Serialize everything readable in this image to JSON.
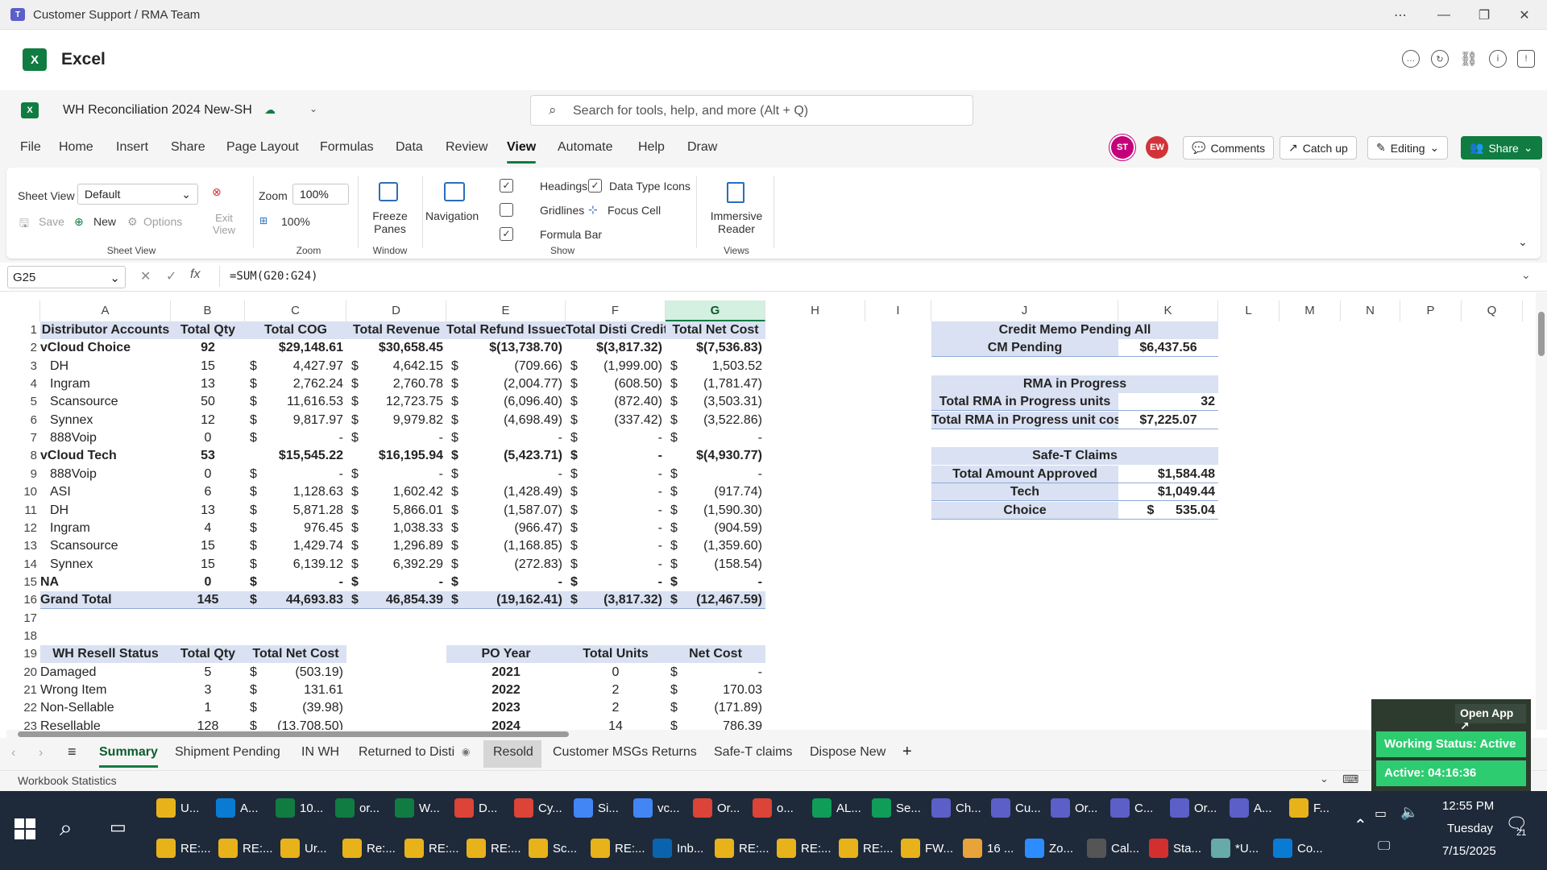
{
  "window": {
    "title": "Customer Support / RMA Team"
  },
  "app": {
    "name": "Excel"
  },
  "doc": {
    "name": "WH Reconciliation 2024 New-SH"
  },
  "search": {
    "placeholder": "Search for tools, help, and more (Alt + Q)"
  },
  "menu": [
    "File",
    "Home",
    "Insert",
    "Share",
    "Page Layout",
    "Formulas",
    "Data",
    "Review",
    "View",
    "Automate",
    "Help",
    "Draw"
  ],
  "menu_active": "View",
  "collaborators": [
    {
      "initials": "ST",
      "color": "#c4007a"
    },
    {
      "initials": "EW",
      "color": "#d13438"
    }
  ],
  "header_buttons": {
    "comments": "Comments",
    "catchup": "Catch up",
    "editing": "Editing",
    "share": "Share"
  },
  "ribbon": {
    "sheet_view_label": "Sheet View",
    "sheet_view_value": "Default",
    "save": "Save",
    "new": "New",
    "options": "Options",
    "exit_view": "Exit View",
    "zoom_label": "Zoom",
    "zoom_value": "100%",
    "zoom_100": "100%",
    "freeze_panes": "Freeze Panes",
    "navigation": "Navigation",
    "headings": "Headings",
    "gridlines": "Gridlines",
    "formula_bar": "Formula Bar",
    "data_type_icons": "Data Type Icons",
    "focus_cell": "Focus Cell",
    "immersive_reader": "Immersive Reader",
    "groups": {
      "sheet_view": "Sheet View",
      "zoom": "Zoom",
      "window": "Window",
      "show": "Show",
      "views": "Views"
    },
    "checks": {
      "headings": true,
      "gridlines": false,
      "formula_bar": true,
      "data_type_icons": true
    }
  },
  "formula_bar": {
    "name_box": "G25",
    "formula": "=SUM(G20:G24)"
  },
  "columns": [
    "A",
    "B",
    "C",
    "D",
    "E",
    "F",
    "G",
    "H",
    "I",
    "J",
    "K",
    "L",
    "M",
    "N",
    "P",
    "Q"
  ],
  "rows": [
    "1",
    "2",
    "3",
    "4",
    "5",
    "6",
    "7",
    "8",
    "9",
    "10",
    "11",
    "12",
    "13",
    "14",
    "15",
    "16",
    "17",
    "18",
    "19",
    "20",
    "21",
    "22",
    "23"
  ],
  "table1": {
    "headers": [
      "Distributor Accounts",
      "Total Qty",
      "Total COG",
      "Total Revenue",
      "Total Refund Issued",
      "Total Disti Credit",
      "Total Net Cost"
    ],
    "rows": [
      {
        "name": "vCloud Choice",
        "qty": "92",
        "cog": "$29,148.61",
        "rev": "$30,658.45",
        "ref": "$(13,738.70)",
        "cred": "$(3,817.32)",
        "net": "$(7,536.83)",
        "style": "sub"
      },
      {
        "name": "DH",
        "qty": "15",
        "cog": "4,427.97",
        "rev": "4,642.15",
        "ref": "(709.66)",
        "cred": "(1,999.00)",
        "net": "1,503.52"
      },
      {
        "name": "Ingram",
        "qty": "13",
        "cog": "2,762.24",
        "rev": "2,760.78",
        "ref": "(2,004.77)",
        "cred": "(608.50)",
        "net": "(1,781.47)"
      },
      {
        "name": "Scansource",
        "qty": "50",
        "cog": "11,616.53",
        "rev": "12,723.75",
        "ref": "(6,096.40)",
        "cred": "(872.40)",
        "net": "(3,503.31)"
      },
      {
        "name": "Synnex",
        "qty": "12",
        "cog": "9,817.97",
        "rev": "9,979.82",
        "ref": "(4,698.49)",
        "cred": "(337.42)",
        "net": "(3,522.86)"
      },
      {
        "name": "888Voip",
        "qty": "0",
        "cog": "-",
        "rev": "-",
        "ref": "-",
        "cred": "-",
        "net": "-"
      },
      {
        "name": "vCloud Tech",
        "qty": "53",
        "cog": "$15,545.22",
        "rev": "$16,195.94",
        "ref": "(5,423.71)",
        "cred": "-",
        "net": "$(4,930.77)",
        "style": "sub2"
      },
      {
        "name": "888Voip",
        "qty": "0",
        "cog": "-",
        "rev": "-",
        "ref": "-",
        "cred": "-",
        "net": "-"
      },
      {
        "name": "ASI",
        "qty": "6",
        "cog": "1,128.63",
        "rev": "1,602.42",
        "ref": "(1,428.49)",
        "cred": "-",
        "net": "(917.74)"
      },
      {
        "name": "DH",
        "qty": "13",
        "cog": "5,871.28",
        "rev": "5,866.01",
        "ref": "(1,587.07)",
        "cred": "-",
        "net": "(1,590.30)"
      },
      {
        "name": "Ingram",
        "qty": "4",
        "cog": "976.45",
        "rev": "1,038.33",
        "ref": "(966.47)",
        "cred": "-",
        "net": "(904.59)"
      },
      {
        "name": "Scansource",
        "qty": "15",
        "cog": "1,429.74",
        "rev": "1,296.89",
        "ref": "(1,168.85)",
        "cred": "-",
        "net": "(1,359.60)"
      },
      {
        "name": "Synnex",
        "qty": "15",
        "cog": "6,139.12",
        "rev": "6,392.29",
        "ref": "(272.83)",
        "cred": "-",
        "net": "(158.54)"
      },
      {
        "name": "NA",
        "qty": "0",
        "cog": "-",
        "rev": "-",
        "ref": "-",
        "cred": "-",
        "net": "-",
        "style": "na"
      },
      {
        "name": "Grand Total",
        "qty": "145",
        "cog": "44,693.83",
        "rev": "46,854.39",
        "ref": "(19,162.41)",
        "cred": "(3,817.32)",
        "net": "(12,467.59)",
        "style": "total"
      }
    ]
  },
  "credit_memo": {
    "title": "Credit Memo Pending All",
    "label": "CM Pending",
    "value": "$6,437.56"
  },
  "rma": {
    "title": "RMA in Progress",
    "units_label": "Total RMA in Progress units",
    "units_value": "32",
    "cost_label": "Total RMA in Progress unit cost",
    "cost_value": "$7,225.07"
  },
  "safet": {
    "title": "Safe-T Claims",
    "rows": [
      {
        "label": "Total Amount Approved",
        "value": "$1,584.48"
      },
      {
        "label": "Tech",
        "value": "$1,049.44"
      },
      {
        "label": "Choice",
        "value": "$      535.04"
      }
    ]
  },
  "resell": {
    "headers": [
      "WH Resell Status",
      "Total Qty",
      "Total Net Cost"
    ],
    "rows": [
      {
        "name": "Damaged",
        "qty": "5",
        "cost": "(503.19)"
      },
      {
        "name": "Wrong Item",
        "qty": "3",
        "cost": "131.61"
      },
      {
        "name": "Non-Sellable",
        "qty": "1",
        "cost": "(39.98)"
      },
      {
        "name": "Resellable",
        "qty": "128",
        "cost": "(13,708.50)"
      }
    ]
  },
  "po": {
    "headers": [
      "PO Year",
      "Total Units",
      "Net Cost"
    ],
    "rows": [
      {
        "year": "2021",
        "units": "0",
        "cost": "-"
      },
      {
        "year": "2022",
        "units": "2",
        "cost": "170.03"
      },
      {
        "year": "2023",
        "units": "2",
        "cost": "(171.89)"
      },
      {
        "year": "2024",
        "units": "14",
        "cost": "786.39"
      }
    ]
  },
  "sheet_tabs": [
    "Summary",
    "Shipment Pending",
    "IN WH",
    "Returned to Disti",
    "Resold",
    "Customer MSGs Returns",
    "Safe-T claims",
    "Dispose New"
  ],
  "active_tab": "Summary",
  "status_bar": {
    "left": "Workbook Statistics"
  },
  "widget": {
    "open_app": "Open App",
    "status": "Working Status: Active",
    "active": "Active: 04:16:36",
    "zoom": "100%"
  },
  "taskbar": {
    "row1": [
      {
        "label": "U...",
        "icon": "folder-icon",
        "color": "#e8b21a"
      },
      {
        "label": "A...",
        "icon": "edge-icon",
        "color": "#0a7bd3"
      },
      {
        "label": "10...",
        "icon": "excel-icon",
        "color": "#107c41"
      },
      {
        "label": "or...",
        "icon": "excel-icon",
        "color": "#107c41"
      },
      {
        "label": "W...",
        "icon": "excel-icon",
        "color": "#107c41"
      },
      {
        "label": "D...",
        "icon": "chrome-icon",
        "color": "#db4437"
      },
      {
        "label": "Cy...",
        "icon": "chrome-icon",
        "color": "#db4437"
      },
      {
        "label": "Si...",
        "icon": "chrome-icon",
        "color": "#4285f4"
      },
      {
        "label": "vc...",
        "icon": "chrome-icon",
        "color": "#4285f4"
      },
      {
        "label": "Or...",
        "icon": "chrome-icon",
        "color": "#db4437"
      },
      {
        "label": "o...",
        "icon": "chrome-icon",
        "color": "#db4437"
      },
      {
        "label": "AL...",
        "icon": "chrome-icon",
        "color": "#0f9d58"
      },
      {
        "label": "Se...",
        "icon": "chrome-icon",
        "color": "#0f9d58"
      },
      {
        "label": "Ch...",
        "icon": "teams-icon",
        "color": "#5b5fc7"
      },
      {
        "label": "Cu...",
        "icon": "teams-icon",
        "color": "#5b5fc7"
      },
      {
        "label": "Or...",
        "icon": "teams-icon",
        "color": "#5b5fc7"
      },
      {
        "label": "C...",
        "icon": "teams-icon",
        "color": "#5b5fc7"
      },
      {
        "label": "Or...",
        "icon": "teams-icon",
        "color": "#5b5fc7"
      },
      {
        "label": "A...",
        "icon": "teams-icon",
        "color": "#5b5fc7"
      },
      {
        "label": "F...",
        "icon": "mail-icon",
        "color": "#e8b21a"
      }
    ],
    "row2": [
      {
        "label": "RE:...",
        "icon": "mail-icon",
        "color": "#e8b21a"
      },
      {
        "label": "RE:...",
        "icon": "mail-icon",
        "color": "#e8b21a"
      },
      {
        "label": "Ur...",
        "icon": "mail-icon",
        "color": "#e8b21a"
      },
      {
        "label": "Re:...",
        "icon": "mail-icon",
        "color": "#e8b21a"
      },
      {
        "label": "RE:...",
        "icon": "mail-icon",
        "color": "#e8b21a"
      },
      {
        "label": "RE:...",
        "icon": "mail-icon",
        "color": "#e8b21a"
      },
      {
        "label": "Sc...",
        "icon": "mail-icon",
        "color": "#e8b21a"
      },
      {
        "label": "RE:...",
        "icon": "mail-icon",
        "color": "#e8b21a"
      },
      {
        "label": "Inb...",
        "icon": "outlook-icon",
        "color": "#0a64ad"
      },
      {
        "label": "RE:...",
        "icon": "mail-icon",
        "color": "#e8b21a"
      },
      {
        "label": "RE:...",
        "icon": "mail-icon",
        "color": "#e8b21a"
      },
      {
        "label": "RE:...",
        "icon": "mail-icon",
        "color": "#e8b21a"
      },
      {
        "label": "FW...",
        "icon": "mail-icon",
        "color": "#e8b21a"
      },
      {
        "label": "16 ...",
        "icon": "bell-icon",
        "color": "#e8a33a"
      },
      {
        "label": "Zo...",
        "icon": "zoom-icon",
        "color": "#2d8cff"
      },
      {
        "label": "Cal...",
        "icon": "calculator-icon",
        "color": "#555"
      },
      {
        "label": "Sta...",
        "icon": "pdf-icon",
        "color": "#d32f2f"
      },
      {
        "label": "*U...",
        "icon": "notepad-icon",
        "color": "#6aa"
      },
      {
        "label": "Co...",
        "icon": "app-icon",
        "color": "#0a7bd3"
      }
    ],
    "time": "12:55 PM",
    "day": "Tuesday",
    "date": "7/15/2025",
    "notif_count": "21"
  }
}
